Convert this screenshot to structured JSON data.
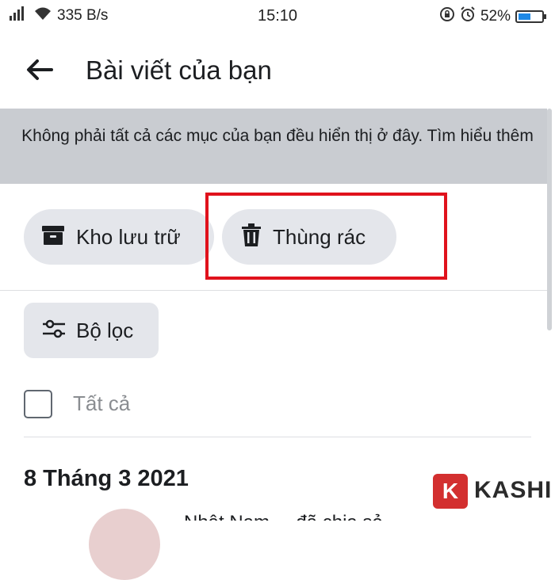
{
  "status_bar": {
    "network_speed": "335 B/s",
    "time": "15:10",
    "battery_percent": "52%",
    "battery_level": 0.52,
    "icons": [
      "signal-icon",
      "wifi-icon",
      "rotation-lock-icon",
      "alarm-icon",
      "battery-icon"
    ]
  },
  "header": {
    "title": "Bài viết của bạn"
  },
  "banner": {
    "text": "Không phải tất cả các mục của bạn đều hiển thị ở đây. Tìm hiểu thêm"
  },
  "actions": {
    "archive_label": "Kho lưu trữ",
    "trash_label": "Thùng rác"
  },
  "filter": {
    "label": "Bộ lọc"
  },
  "select_all": {
    "label": "Tất cả",
    "checked": false
  },
  "posts": {
    "date_heading": "8 Tháng 3 2021",
    "first_post_text": "Nhật Nam ... đã chia sẻ"
  },
  "watermark": {
    "mark": "K",
    "brand": "KASHI",
    "color": "#d32f2f"
  },
  "colors": {
    "highlight": "#e0121c",
    "pill_bg": "#e4e6eb",
    "banner_bg": "#c9ccd1"
  }
}
